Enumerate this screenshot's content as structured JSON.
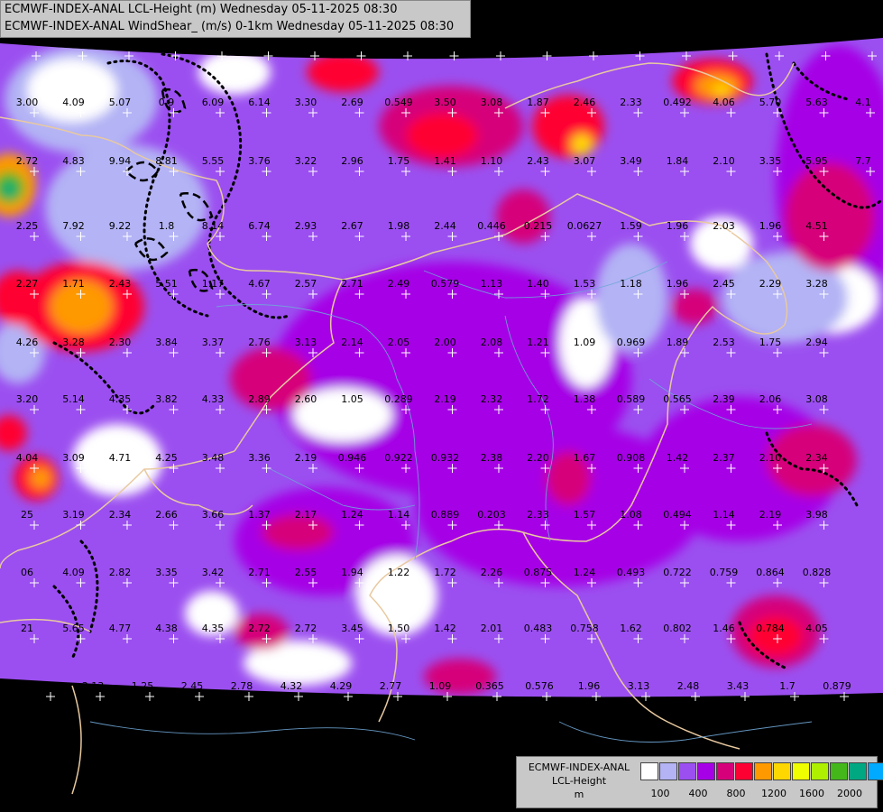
{
  "header": {
    "line1": "ECMWF-INDEX-ANAL LCL-Height (m) Wednesday 05-11-2025 08:30",
    "line2": "ECMWF-INDEX-ANAL WindShear_ (m/s) 0-1km Wednesday 05-11-2025 08:30"
  },
  "legend": {
    "model": "ECMWF-INDEX-ANAL",
    "param": "LCL-Height",
    "unit": "m",
    "colors": [
      "#ffffff",
      "#b3b3f5",
      "#9b4ff0",
      "#a600e6",
      "#d6007a",
      "#ff0033",
      "#ff9900",
      "#ffd700",
      "#f0ff00",
      "#aef000",
      "#44b81a",
      "#00a882",
      "#00aaff"
    ],
    "ticks": [
      "100",
      "400",
      "800",
      "1200",
      "1600",
      "2000"
    ]
  },
  "values_rows": [
    [
      "3.00",
      "4.09",
      "5.07",
      "0.9",
      "6.09",
      "6.14",
      "3.30",
      "2.69",
      "0.549",
      "3.50",
      "3.08",
      "1.87",
      "2.46",
      "2.33",
      "0.492",
      "4.06",
      "5.70",
      "5.63",
      "4.1"
    ],
    [
      "2.72",
      "4.83",
      "9.94",
      "8.81",
      "5.55",
      "3.76",
      "3.22",
      "2.96",
      "1.75",
      "1.41",
      "1.10",
      "2.43",
      "3.07",
      "3.49",
      "1.84",
      "2.10",
      "3.35",
      "5.95",
      "7.7"
    ],
    [
      "2.25",
      "7.92",
      "9.22",
      "1.8",
      "8.14",
      "6.74",
      "2.93",
      "2.67",
      "1.98",
      "2.44",
      "0.446",
      "0.215",
      "0.0627",
      "1.59",
      "1.96",
      "2.03",
      "1.96",
      "4.51"
    ],
    [
      "2.27",
      "1.71",
      "2.43",
      "5.51",
      "1.17",
      "4.67",
      "2.57",
      "2.71",
      "2.49",
      "0.579",
      "1.13",
      "1.40",
      "1.53",
      "1.18",
      "1.96",
      "2.45",
      "2.29",
      "3.28"
    ],
    [
      "4.26",
      "3.28",
      "2.30",
      "3.84",
      "3.37",
      "2.76",
      "3.13",
      "2.14",
      "2.05",
      "2.00",
      "2.08",
      "1.21",
      "1.09",
      "0.969",
      "1.89",
      "2.53",
      "1.75",
      "2.94"
    ],
    [
      "3.20",
      "5.14",
      "4.35",
      "3.82",
      "4.33",
      "2.89",
      "2.60",
      "1.05",
      "0.289",
      "2.19",
      "2.32",
      "1.72",
      "1.38",
      "0.589",
      "0.565",
      "2.39",
      "2.06",
      "3.08"
    ],
    [
      "4.04",
      "3.09",
      "4.71",
      "4.25",
      "3.48",
      "3.36",
      "2.19",
      "0.946",
      "0.922",
      "0.932",
      "2.38",
      "2.20",
      "1.67",
      "0.908",
      "1.42",
      "2.37",
      "2.10",
      "2.34"
    ],
    [
      "25",
      "3.19",
      "2.34",
      "2.66",
      "3.66",
      "1.37",
      "2.17",
      "1.24",
      "1.14",
      "0.889",
      "0.203",
      "2.33",
      "1.57",
      "1.08",
      "0.494",
      "1.14",
      "2.19",
      "3.98"
    ],
    [
      "06",
      "4.09",
      "2.82",
      "3.35",
      "3.42",
      "2.71",
      "2.55",
      "1.94",
      "1.22",
      "1.72",
      "2.26",
      "0.875",
      "1.24",
      "0.493",
      "0.722",
      "0.759",
      "0.864",
      "0.828"
    ],
    [
      "21",
      "5.65",
      "4.77",
      "4.38",
      "4.35",
      "2.72",
      "2.72",
      "3.45",
      "1.50",
      "1.42",
      "2.01",
      "0.483",
      "0.758",
      "1.62",
      "0.802",
      "1.46",
      "0.784",
      "4.05"
    ],
    [
      "5",
      "3.13",
      "1.25",
      "2.45",
      "2.78",
      "4.32",
      "4.29",
      "2.77",
      "1.09",
      "0.365",
      "0.576",
      "1.96",
      "3.13",
      "2.48",
      "3.43",
      "1.7",
      "0.879"
    ]
  ]
}
